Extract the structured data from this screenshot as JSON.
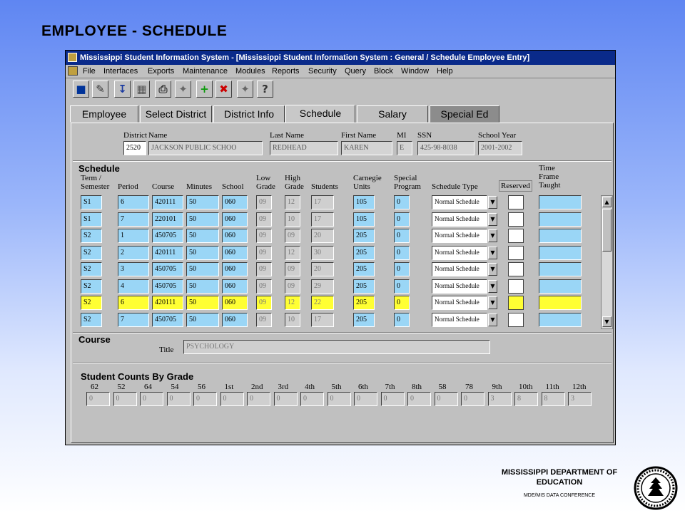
{
  "slide_title": "EMPLOYEE  - SCHEDULE",
  "window_title": "Mississippi Student Information System - [Mississippi Student Information System : General / Schedule Employee Entry]",
  "menu": [
    "File",
    "Interfaces",
    "Exports",
    "Maintenance",
    "Modules",
    "Reports",
    "Security",
    "Query",
    "Block",
    "Window",
    "Help"
  ],
  "toolbar_icons": [
    "save-icon",
    "edit-icon",
    "download-icon",
    "preview-icon",
    "print-icon",
    "magic-wand-icon",
    "add-record-icon",
    "delete-record-icon",
    "wand-icon",
    "help-icon"
  ],
  "tabs": [
    "Employee",
    "Select District",
    "District Info",
    "Schedule",
    "Salary",
    "Special Ed"
  ],
  "active_tab": "Schedule",
  "header_labels": {
    "district": "District",
    "name": "Name",
    "last_name": "Last Name",
    "first_name": "First Name",
    "mi": "MI",
    "ssn": "SSN",
    "school_year": "School Year"
  },
  "header_values": {
    "district": "2520",
    "name": "JACKSON PUBLIC SCHOO",
    "last_name": "REDHEAD",
    "first_name": "KAREN",
    "mi": "E",
    "ssn": "425-98-8038",
    "school_year": "2001-2002"
  },
  "schedule": {
    "section_title": "Schedule",
    "columns": {
      "term": [
        "Term /",
        "Semester"
      ],
      "period": "Period",
      "course": "Course",
      "minutes": "Minutes",
      "school": "School",
      "low_grade": [
        "Low",
        "Grade"
      ],
      "high_grade": [
        "High",
        "Grade"
      ],
      "students": "Students",
      "carnegie": [
        "Carnegie",
        "Units"
      ],
      "special_program": [
        "Special",
        "Program"
      ],
      "schedule_type": "Schedule Type",
      "reserved": "Reserved",
      "time_frame": [
        "Time",
        "Frame",
        "Taught"
      ]
    },
    "rows": [
      {
        "term": "S1",
        "period": "6",
        "course": "420111",
        "minutes": "50",
        "school": "060",
        "low": "09",
        "high": "12",
        "students": "17",
        "carnegie": "105",
        "special": "0",
        "type": "Normal Schedule"
      },
      {
        "term": "S1",
        "period": "7",
        "course": "220101",
        "minutes": "50",
        "school": "060",
        "low": "09",
        "high": "10",
        "students": "17",
        "carnegie": "105",
        "special": "0",
        "type": "Normal Schedule"
      },
      {
        "term": "S2",
        "period": "1",
        "course": "450705",
        "minutes": "50",
        "school": "060",
        "low": "09",
        "high": "09",
        "students": "20",
        "carnegie": "205",
        "special": "0",
        "type": "Normal Schedule"
      },
      {
        "term": "S2",
        "period": "2",
        "course": "420111",
        "minutes": "50",
        "school": "060",
        "low": "09",
        "high": "12",
        "students": "30",
        "carnegie": "205",
        "special": "0",
        "type": "Normal Schedule"
      },
      {
        "term": "S2",
        "period": "3",
        "course": "450705",
        "minutes": "50",
        "school": "060",
        "low": "09",
        "high": "09",
        "students": "20",
        "carnegie": "205",
        "special": "0",
        "type": "Normal Schedule"
      },
      {
        "term": "S2",
        "period": "4",
        "course": "450705",
        "minutes": "50",
        "school": "060",
        "low": "09",
        "high": "09",
        "students": "29",
        "carnegie": "205",
        "special": "0",
        "type": "Normal Schedule"
      },
      {
        "term": "S2",
        "period": "6",
        "course": "420111",
        "minutes": "50",
        "school": "060",
        "low": "09",
        "high": "12",
        "students": "22",
        "carnegie": "205",
        "special": "0",
        "type": "Normal Schedule"
      },
      {
        "term": "S2",
        "period": "7",
        "course": "450705",
        "minutes": "50",
        "school": "060",
        "low": "09",
        "high": "10",
        "students": "17",
        "carnegie": "205",
        "special": "0",
        "type": "Normal Schedule"
      }
    ],
    "highlighted_row": 6
  },
  "course": {
    "section_title": "Course",
    "title_label": "Title",
    "title_value": "PSYCHOLOGY"
  },
  "student_counts": {
    "section_title": "Student Counts By Grade",
    "grades": [
      "62",
      "52",
      "64",
      "54",
      "56",
      "1st",
      "2nd",
      "3rd",
      "4th",
      "5th",
      "6th",
      "7th",
      "8th",
      "58",
      "78",
      "9th",
      "10th",
      "11th",
      "12th"
    ],
    "values": [
      "0",
      "0",
      "0",
      "0",
      "0",
      "0",
      "0",
      "0",
      "0",
      "0",
      "0",
      "0",
      "0",
      "0",
      "0",
      "3",
      "8",
      "8",
      "3"
    ]
  },
  "footer": {
    "org_line1": "MISSISSIPPI DEPARTMENT OF",
    "org_line2": "EDUCATION",
    "sub": "MDE/MIS DATA CONFERENCE"
  },
  "colors": {
    "field_blue": "#9ad6f6",
    "highlight_yellow": "#ffff33",
    "title_bar": "#0a2a8a"
  }
}
